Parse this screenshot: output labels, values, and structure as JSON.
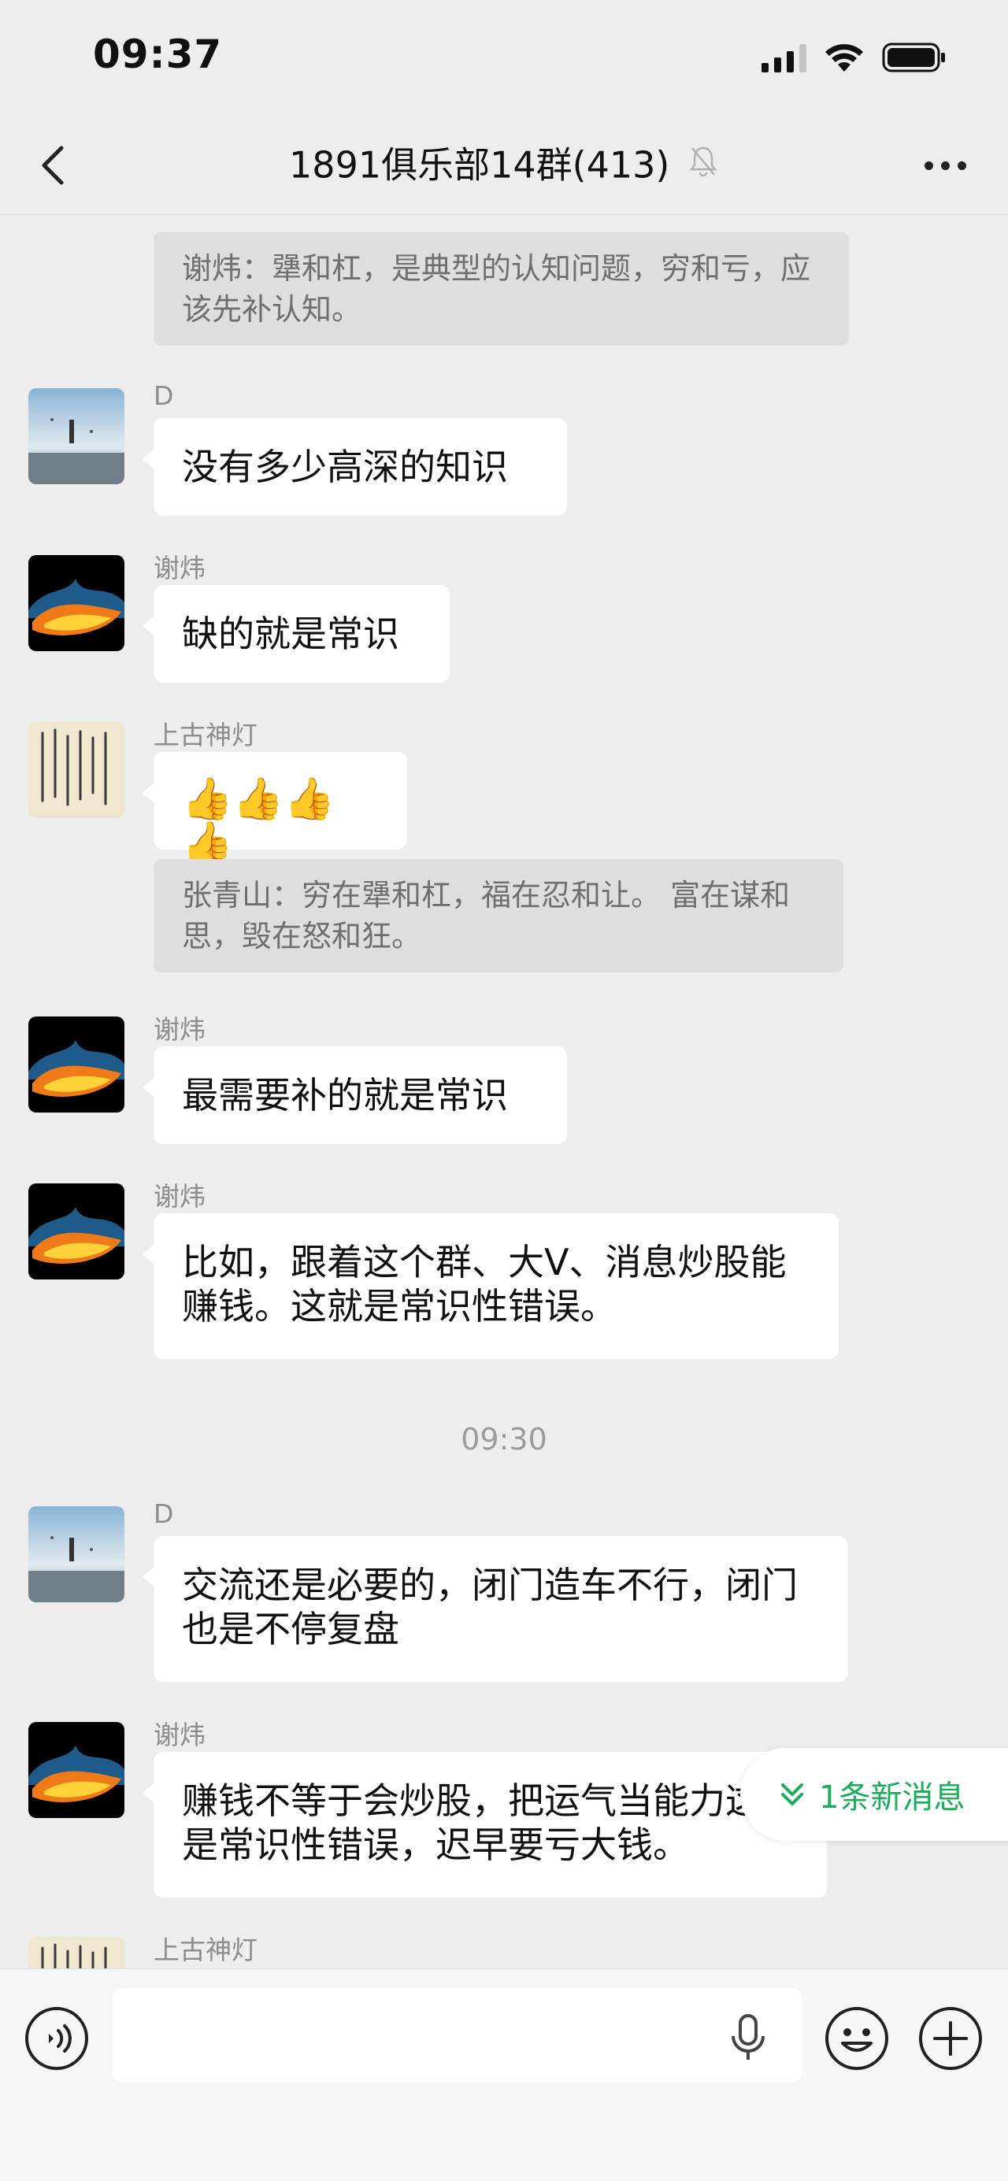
{
  "status_bar": {
    "time": "09:37"
  },
  "header": {
    "title": "1891俱乐部14群(413)"
  },
  "messages": [
    {
      "quote": "谢炜：犟和杠，是典型的认知问题，穷和亏，应该先补认知。"
    },
    {
      "sender": "D",
      "text": "没有多少高深的知识"
    },
    {
      "sender": "谢炜",
      "text": "缺的就是常识"
    },
    {
      "sender": "上古神灯",
      "text": "👍👍👍👍",
      "quote": "张青山：穷在犟和杠，福在忍和让。 富在谋和思，毁在怒和狂。"
    },
    {
      "sender": "谢炜",
      "text": "最需要补的就是常识"
    },
    {
      "sender": "谢炜",
      "text": "比如，跟着这个群、大V、消息炒股能赚钱。这就是常识性错误。"
    },
    {
      "time": "09:30"
    },
    {
      "sender": "D",
      "text": "交流还是必要的，闭门造车不行，闭门也是不停复盘"
    },
    {
      "sender": "谢炜",
      "text": "赚钱不等于会炒股，把运气当能力这也是常识性错误，迟早要亏大钱。"
    },
    {
      "sender": "上古神灯"
    }
  ],
  "new_message_pill": {
    "label": "1条新消息"
  },
  "input_bar": {
    "placeholder": ""
  },
  "colors": {
    "background": "#ededed",
    "bubble": "#ffffff",
    "quote_bg": "#dedede",
    "accent_green": "#1aad5a"
  }
}
